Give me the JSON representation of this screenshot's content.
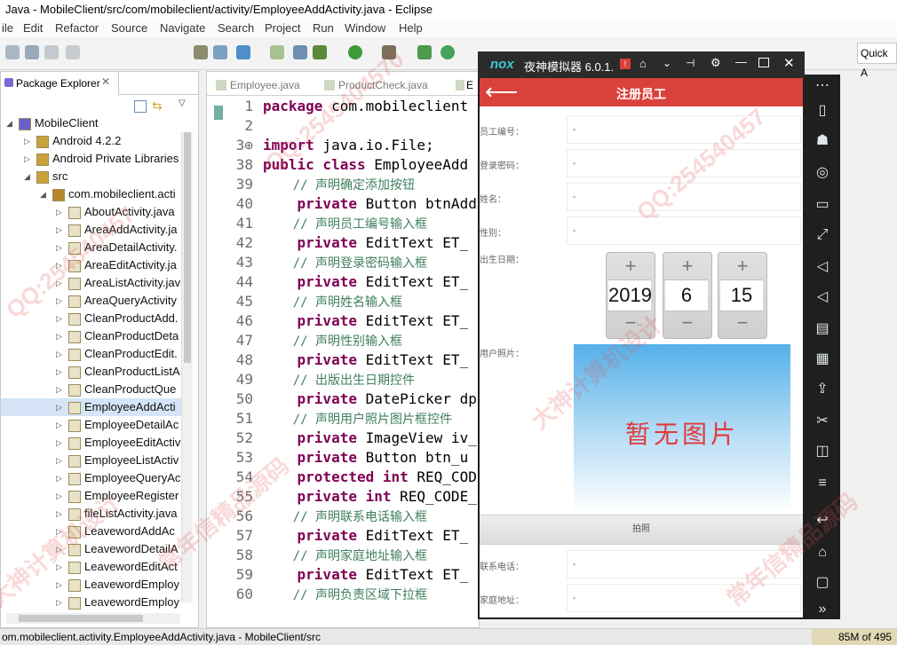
{
  "window": {
    "title": "Java - MobileClient/src/com/mobileclient/activity/EmployeeAddActivity.java - Eclipse"
  },
  "menu": [
    "ile",
    "Edit",
    "Refactor",
    "Source",
    "Navigate",
    "Search",
    "Project",
    "Run",
    "Window",
    "Help"
  ],
  "toolbar": {
    "quick_access": "Quick A"
  },
  "package_explorer": {
    "tab_label": "Package Explorer",
    "tree": [
      {
        "label": "MobileClient",
        "level": 0,
        "twisty": "◢"
      },
      {
        "label": "Android 4.2.2",
        "level": 1,
        "twisty": "▷"
      },
      {
        "label": "Android Private Libraries",
        "level": 1,
        "twisty": "▷"
      },
      {
        "label": "src",
        "level": 1,
        "twisty": "◢"
      },
      {
        "label": "com.mobileclient.acti",
        "level": 2,
        "twisty": "◢"
      },
      {
        "label": "AboutActivity.java",
        "level": 3,
        "twisty": "▷"
      },
      {
        "label": "AreaAddActivity.ja",
        "level": 3,
        "twisty": "▷"
      },
      {
        "label": "AreaDetailActivity.",
        "level": 3,
        "twisty": "▷"
      },
      {
        "label": "AreaEditActivity.ja",
        "level": 3,
        "twisty": "▷"
      },
      {
        "label": "AreaListActivity.jav",
        "level": 3,
        "twisty": "▷"
      },
      {
        "label": "AreaQueryActivity",
        "level": 3,
        "twisty": "▷"
      },
      {
        "label": "CleanProductAdd.",
        "level": 3,
        "twisty": "▷"
      },
      {
        "label": "CleanProductDeta",
        "level": 3,
        "twisty": "▷"
      },
      {
        "label": "CleanProductEdit.",
        "level": 3,
        "twisty": "▷"
      },
      {
        "label": "CleanProductListA",
        "level": 3,
        "twisty": "▷"
      },
      {
        "label": "CleanProductQue",
        "level": 3,
        "twisty": "▷"
      },
      {
        "label": "EmployeeAddActi",
        "level": 3,
        "twisty": "▷",
        "selected": true
      },
      {
        "label": "EmployeeDetailAc",
        "level": 3,
        "twisty": "▷"
      },
      {
        "label": "EmployeeEditActiv",
        "level": 3,
        "twisty": "▷"
      },
      {
        "label": "EmployeeListActiv",
        "level": 3,
        "twisty": "▷"
      },
      {
        "label": "EmployeeQueryAc",
        "level": 3,
        "twisty": "▷"
      },
      {
        "label": "EmployeeRegister",
        "level": 3,
        "twisty": "▷"
      },
      {
        "label": "fileListActivity.java",
        "level": 3,
        "twisty": "▷"
      },
      {
        "label": "LeavewordAddAc",
        "level": 3,
        "twisty": "▷"
      },
      {
        "label": "LeavewordDetailA",
        "level": 3,
        "twisty": "▷"
      },
      {
        "label": "LeavewordEditAct",
        "level": 3,
        "twisty": "▷"
      },
      {
        "label": "LeavewordEmploy",
        "level": 3,
        "twisty": "▷"
      },
      {
        "label": "LeavewordEmploy",
        "level": 3,
        "twisty": "▷"
      }
    ]
  },
  "editor": {
    "tabs": [
      "Employee.java",
      "ProductCheck.java",
      "E"
    ],
    "lines": [
      {
        "n": "1",
        "kw": "package",
        "rest": " com.mobileclient"
      },
      {
        "n": "2",
        "kw": "",
        "rest": ""
      },
      {
        "n": "3⊕",
        "kw": "import",
        "rest": " java.io.File;"
      },
      {
        "n": "38",
        "kw": "public class",
        "rest": " EmployeeAdd"
      },
      {
        "n": "39",
        "comment": "    // 声明确定添加按钮"
      },
      {
        "n": "40",
        "kw": "    private",
        "rest": " Button btnAdd"
      },
      {
        "n": "41",
        "comment": "    // 声明员工编号输入框"
      },
      {
        "n": "42",
        "kw": "    private",
        "rest": " EditText ET_"
      },
      {
        "n": "43",
        "comment": "    // 声明登录密码输入框"
      },
      {
        "n": "44",
        "kw": "    private",
        "rest": " EditText ET_"
      },
      {
        "n": "45",
        "comment": "    // 声明姓名输入框"
      },
      {
        "n": "46",
        "kw": "    private",
        "rest": " EditText ET_"
      },
      {
        "n": "47",
        "comment": "    // 声明性别输入框"
      },
      {
        "n": "48",
        "kw": "    private",
        "rest": " EditText ET_"
      },
      {
        "n": "49",
        "comment": "    // 出版出生日期控件"
      },
      {
        "n": "50",
        "kw": "    private",
        "rest": " DatePicker dp"
      },
      {
        "n": "51",
        "comment": "    // 声明用户照片图片框控件"
      },
      {
        "n": "52",
        "kw": "    private",
        "rest": " ImageView iv_"
      },
      {
        "n": "53",
        "kw": "    private",
        "rest": " Button btn_u"
      },
      {
        "n": "54",
        "kw": "    protected int",
        "rest": " REQ_COD"
      },
      {
        "n": "55",
        "kw": "    private int",
        "rest": " REQ_CODE_"
      },
      {
        "n": "56",
        "comment": "    // 声明联系电话输入框"
      },
      {
        "n": "57",
        "kw": "    private",
        "rest": " EditText ET_"
      },
      {
        "n": "58",
        "comment": "    // 声明家庭地址输入框"
      },
      {
        "n": "59",
        "kw": "    private",
        "rest": " EditText ET_"
      },
      {
        "n": "60",
        "comment": "    // 声明负责区域下拉框"
      }
    ]
  },
  "emulator": {
    "title": "夜神模拟器 6.0.1.",
    "logo": "nox",
    "app_title": "注册员工",
    "fields": [
      {
        "label": "员工编号："
      },
      {
        "label": "登录密码："
      },
      {
        "label": "姓名："
      },
      {
        "label": "性别："
      }
    ],
    "birthday_label": "出生日期：",
    "date": {
      "year": "2019",
      "month": "6",
      "day": "15"
    },
    "photo_label": "用户照片：",
    "photo_placeholder": "暂无图片",
    "shoot_button": "拍照",
    "phone_label": "联系电话：",
    "address_label": "家庭地址："
  },
  "statusbar": {
    "text": "om.mobileclient.activity.EmployeeAddActivity.java - MobileClient/src",
    "memory": "85M of 495"
  },
  "watermarks": [
    "QQ:2545404570",
    "大神计算机设计",
    "常年信精品源码",
    "QQ:254540457",
    "QQ:254540457",
    "常年信精品源码",
    "大神计算机设计"
  ],
  "colors": {
    "emu_accent": "#d9423c",
    "keyword": "#7f0055",
    "comment": "#3f7f5f",
    "selection": "#d5e4f6"
  }
}
